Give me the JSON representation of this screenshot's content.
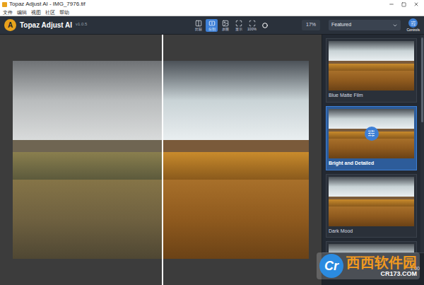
{
  "window": {
    "title": "Topaz Adjust AI - IMG_7976.tif"
  },
  "menu": [
    "文件",
    "编辑",
    "视图",
    "社区",
    "帮助"
  ],
  "app": {
    "logo": "A",
    "name": "Topaz Adjust AI",
    "version": "v1.0.5"
  },
  "view_buttons": [
    {
      "label": "比较",
      "selected": false
    },
    {
      "label": "分割",
      "selected": true
    },
    {
      "label": "原图",
      "selected": false
    },
    {
      "label": "显示",
      "selected": false
    },
    {
      "label": "100%",
      "selected": false
    }
  ],
  "zoom": "17%",
  "preset_dropdown": "Featured",
  "controls_button": "Controls",
  "presets": [
    {
      "name": "Blue Matte Film",
      "selected": false
    },
    {
      "name": "Bright and Detailed",
      "selected": true
    },
    {
      "name": "Dark Mood",
      "selected": false
    },
    {
      "name": "",
      "selected": false
    }
  ],
  "bottom_value": "1.00",
  "watermark": {
    "logo": "Cr",
    "name": "西西软件园",
    "url": "CR173.COM"
  }
}
